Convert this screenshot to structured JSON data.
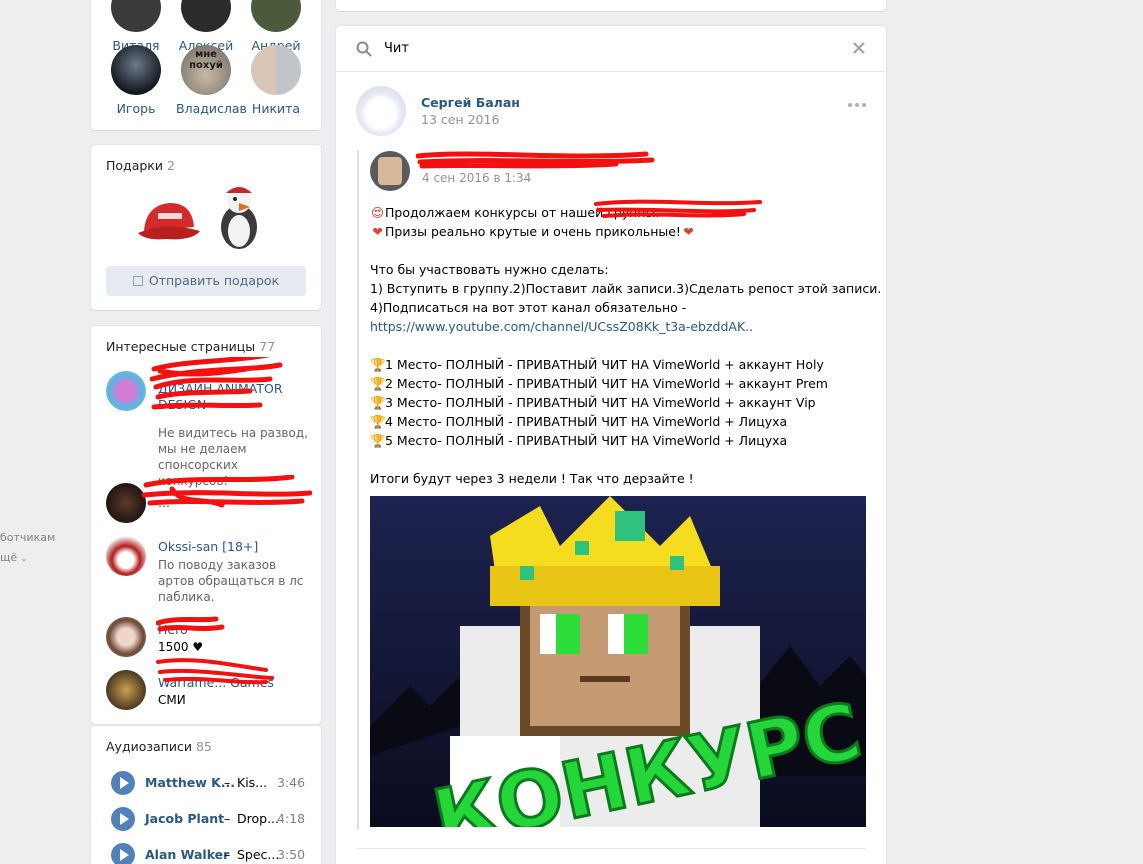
{
  "friends": [
    {
      "name": "Виталя"
    },
    {
      "name": "Алексей"
    },
    {
      "name": "Андрей"
    },
    {
      "name": "Игорь"
    },
    {
      "name": "Владислав",
      "avatar_text": "мне похуй"
    },
    {
      "name": "Никита"
    }
  ],
  "gifts": {
    "title": "Подарки",
    "count": "2",
    "send_label": "Отправить подарок"
  },
  "pages": {
    "title": "Интересные страницы",
    "count": "77",
    "items": [
      {
        "name": "ДИЗАЙН ANIMATOR DESIGN",
        "desc": "Не видитесь на развод, мы не делаем спонсорских конкурсов!"
      },
      {
        "name": "...",
        "desc": ""
      },
      {
        "name": "Okssi-san [18+]",
        "desc": "По поводу заказов артов обращаться в лс паблика."
      },
      {
        "name": "Hero",
        "desc": "1500 ♥"
      },
      {
        "name": "Warfame... Games",
        "desc": "СМИ"
      }
    ]
  },
  "audio": {
    "title": "Аудиозаписи",
    "count": "85",
    "tracks": [
      {
        "artist": "Matthew K...",
        "title": "Kis...",
        "duration": "3:46"
      },
      {
        "artist": "Jacob Plant",
        "title": "Drop...",
        "duration": "4:18"
      },
      {
        "artist": "Alan Walker",
        "title": "Spec...",
        "duration": "3:50"
      }
    ]
  },
  "left_edge": {
    "line1": "ботчикам",
    "line2": "щё"
  },
  "search": {
    "value": "Чит"
  },
  "post": {
    "author": "Сергей Балан",
    "date": "13 сен 2016",
    "repost_date": "4 сен 2016 в 1:34",
    "lines": {
      "l1": "Продолжаем конкурсы от нашей группы:",
      "l2": "Призы реально крутые и очень прикольные!",
      "l3": "Что бы участвовать нужно сделать:",
      "l4": "1) Вступить в группу.2)Поставит лайк записи.3)Сделать репост этой записи.",
      "l5": "4)Подписаться на вот этот канал обязательно -",
      "link": "https://www.youtube.com/channel/UCssZ08Kk_t3a-ebzddAK..",
      "p1": "1 Место- ПОЛНЫЙ - ПРИВАТНЫЙ ЧИТ НА VimeWorld + аккаунт Holy",
      "p2": "2 Место- ПОЛНЫЙ - ПРИВАТНЫЙ ЧИТ НА VimeWorld + аккаунт Prem",
      "p3": "3 Место- ПОЛНЫЙ - ПРИВАТНЫЙ ЧИТ НА VimeWorld + аккаунт Vip",
      "p4": "4 Место- ПОЛНЫЙ - ПРИВАТНЫЙ ЧИТ НА VimeWorld + Лицуха",
      "p5": "5 Место- ПОЛНЫЙ - ПРИВАТНЫЙ ЧИТ НА VimeWorld + Лицуха",
      "end": "Итоги будут через 3 недели ! Так что дерзайте !"
    },
    "image_text": "КОНКУРС"
  }
}
